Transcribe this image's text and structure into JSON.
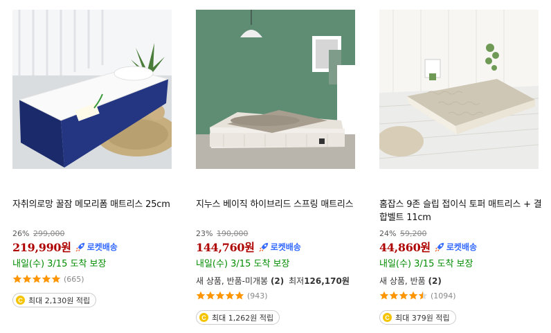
{
  "products": [
    {
      "title": "자취의로망 꿀잠 메모리폼 매트리스 25cm",
      "discount": "26%",
      "original_price": "299,000",
      "sale_price": "219,990원",
      "rocket_label": "로켓배송",
      "arrival": "내일(수) 3/15 도착 보장",
      "rating": 5,
      "review_count": "(665)",
      "cashback": "최대 2,130원 적립",
      "image_icon": "mattress-memory-foam-photo"
    },
    {
      "title": "지누스 베이직 하이브리드 스프링 매트리스",
      "discount": "23%",
      "original_price": "190,000",
      "sale_price": "144,760원",
      "rocket_label": "로켓배송",
      "arrival": "내일(수) 3/15 도착 보장",
      "used_label": "새 상품, 반품-미개봉",
      "used_count": "(2)",
      "lowest_label": "최저",
      "lowest_price": "126,170원",
      "rating": 5,
      "review_count": "(943)",
      "cashback": "최대 1,262원 적립",
      "image_icon": "hybrid-spring-mattress-photo"
    },
    {
      "title": "홈잡스 9존 슬립 접이식 토퍼 매트리스 + 결합벨트 11cm",
      "discount": "24%",
      "original_price": "59,200",
      "sale_price": "44,860원",
      "rocket_label": "로켓배송",
      "arrival": "내일(수) 3/15 도착 보장",
      "used_label": "새 상품, 반품",
      "used_count": "(2)",
      "rating": 4.5,
      "review_count": "(1094)",
      "cashback": "최대 379원 적립",
      "image_icon": "folding-topper-mattress-photo"
    }
  ],
  "colors": {
    "sale_price": "#ae0000",
    "rocket": "#346aff",
    "arrival": "#008c00",
    "star": "#ff9600",
    "cash_icon": "#f4c400"
  },
  "icons": {
    "rocket": "rocket-icon",
    "star": "star-icon",
    "cash": "cash-coin-icon"
  },
  "cash_icon_letter": "C"
}
